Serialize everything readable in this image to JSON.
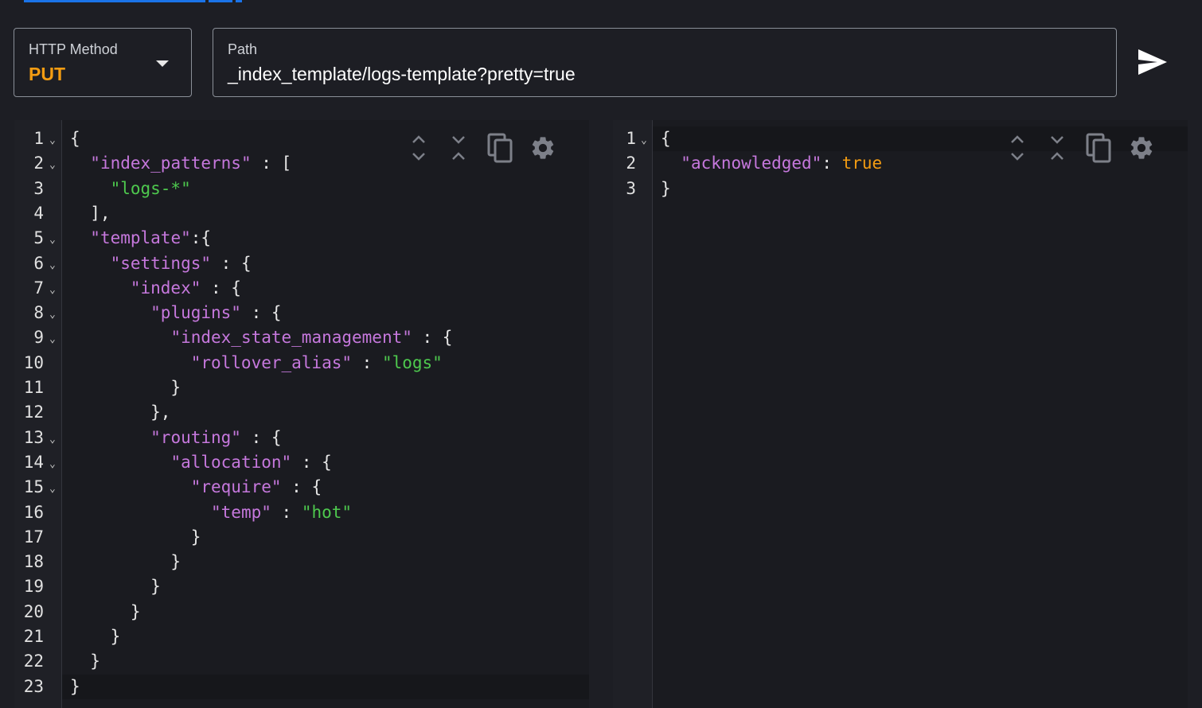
{
  "request": {
    "method_label": "HTTP Method",
    "method_value": "PUT",
    "path_label": "Path",
    "path_value": "_index_template/logs-template?pretty=true"
  },
  "request_body": {
    "lines": [
      [
        {
          "t": "p",
          "v": "{"
        }
      ],
      [
        {
          "t": "p",
          "v": "  "
        },
        {
          "t": "k",
          "v": "\"index_patterns\""
        },
        {
          "t": "p",
          "v": " : ["
        }
      ],
      [
        {
          "t": "p",
          "v": "    "
        },
        {
          "t": "s",
          "v": "\"logs-*\""
        }
      ],
      [
        {
          "t": "p",
          "v": "  ],"
        }
      ],
      [
        {
          "t": "p",
          "v": "  "
        },
        {
          "t": "k",
          "v": "\"template\""
        },
        {
          "t": "p",
          "v": ":{"
        }
      ],
      [
        {
          "t": "p",
          "v": "    "
        },
        {
          "t": "k",
          "v": "\"settings\""
        },
        {
          "t": "p",
          "v": " : {"
        }
      ],
      [
        {
          "t": "p",
          "v": "      "
        },
        {
          "t": "k",
          "v": "\"index\""
        },
        {
          "t": "p",
          "v": " : {"
        }
      ],
      [
        {
          "t": "p",
          "v": "        "
        },
        {
          "t": "k",
          "v": "\"plugins\""
        },
        {
          "t": "p",
          "v": " : {"
        }
      ],
      [
        {
          "t": "p",
          "v": "          "
        },
        {
          "t": "k",
          "v": "\"index_state_management\""
        },
        {
          "t": "p",
          "v": " : {"
        }
      ],
      [
        {
          "t": "p",
          "v": "            "
        },
        {
          "t": "k",
          "v": "\"rollover_alias\""
        },
        {
          "t": "p",
          "v": " : "
        },
        {
          "t": "s",
          "v": "\"logs\""
        }
      ],
      [
        {
          "t": "p",
          "v": "          }"
        }
      ],
      [
        {
          "t": "p",
          "v": "        },"
        }
      ],
      [
        {
          "t": "p",
          "v": "        "
        },
        {
          "t": "k",
          "v": "\"routing\""
        },
        {
          "t": "p",
          "v": " : {"
        }
      ],
      [
        {
          "t": "p",
          "v": "          "
        },
        {
          "t": "k",
          "v": "\"allocation\""
        },
        {
          "t": "p",
          "v": " : {"
        }
      ],
      [
        {
          "t": "p",
          "v": "            "
        },
        {
          "t": "k",
          "v": "\"require\""
        },
        {
          "t": "p",
          "v": " : {"
        }
      ],
      [
        {
          "t": "p",
          "v": "              "
        },
        {
          "t": "k",
          "v": "\"temp\""
        },
        {
          "t": "p",
          "v": " : "
        },
        {
          "t": "s",
          "v": "\"hot\""
        }
      ],
      [
        {
          "t": "p",
          "v": "            }"
        }
      ],
      [
        {
          "t": "p",
          "v": "          }"
        }
      ],
      [
        {
          "t": "p",
          "v": "        }"
        }
      ],
      [
        {
          "t": "p",
          "v": "      }"
        }
      ],
      [
        {
          "t": "p",
          "v": "    }"
        }
      ],
      [
        {
          "t": "p",
          "v": "  }"
        }
      ],
      [
        {
          "t": "p",
          "v": "}"
        }
      ]
    ],
    "foldable": [
      1,
      2,
      5,
      6,
      7,
      8,
      9,
      13,
      14,
      15
    ],
    "active_line": 23
  },
  "response_body": {
    "lines": [
      [
        {
          "t": "p",
          "v": "{"
        }
      ],
      [
        {
          "t": "p",
          "v": "  "
        },
        {
          "t": "k",
          "v": "\"acknowledged\""
        },
        {
          "t": "p",
          "v": ": "
        },
        {
          "t": "b",
          "v": "true"
        }
      ],
      [
        {
          "t": "p",
          "v": "}"
        }
      ]
    ],
    "foldable": [
      1
    ],
    "active_line": 1
  },
  "icons": {
    "expand": "expand-all-icon",
    "collapse": "collapse-all-icon",
    "copy": "copy-icon",
    "settings": "gear-icon",
    "send": "send-icon",
    "dropdown": "chevron-down-icon"
  },
  "colors": {
    "keyword": "#c678dd",
    "string": "#4ec94e",
    "boolean": "#f39c12",
    "method": "#f39c12",
    "link": "#1a73e8"
  }
}
